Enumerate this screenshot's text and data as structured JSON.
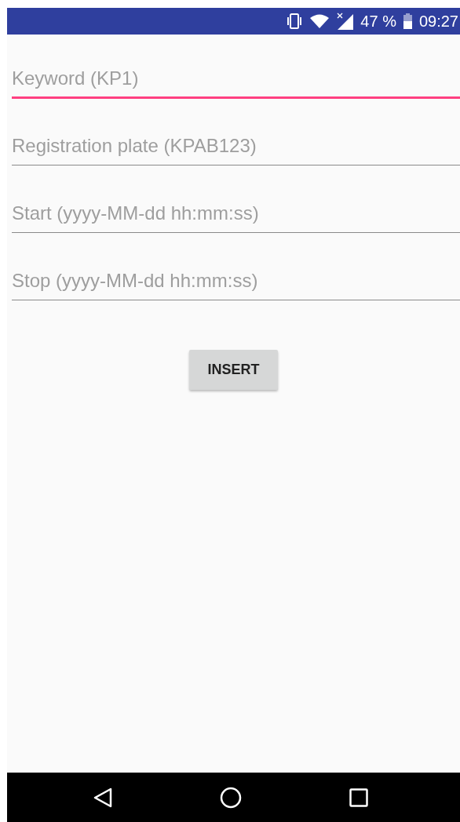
{
  "status_bar": {
    "battery": "47 %",
    "time": "09:27"
  },
  "fields": [
    {
      "placeholder": "Keyword (KP1)",
      "focused": true
    },
    {
      "placeholder": "Registration plate (KPAB123)",
      "focused": false
    },
    {
      "placeholder": "Start (yyyy-MM-dd hh:mm:ss)",
      "focused": false
    },
    {
      "placeholder": "Stop (yyyy-MM-dd hh:mm:ss)",
      "focused": false
    }
  ],
  "button": "INSERT"
}
